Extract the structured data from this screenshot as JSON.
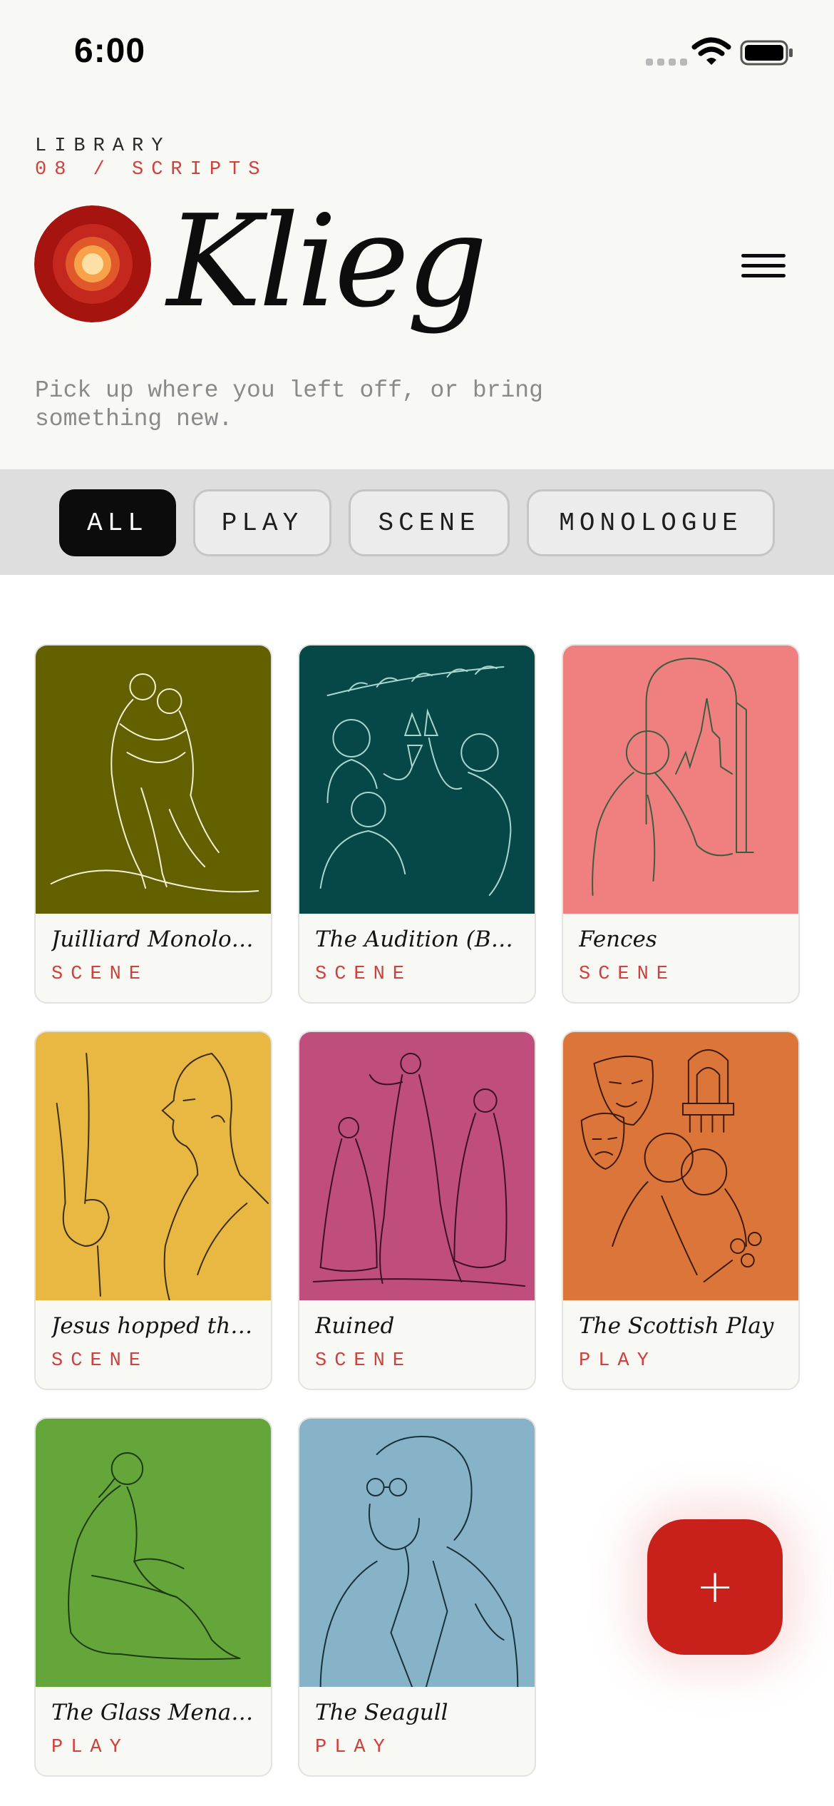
{
  "status_bar": {
    "time": "6:00"
  },
  "header": {
    "eyebrow_1": "LIBRARY",
    "eyebrow_2": "08 / SCRIPTS",
    "brand": "Klieg",
    "subtitle": "Pick up where you left off, or bring something new."
  },
  "filters": [
    "ALL",
    "PLAY",
    "SCENE",
    "MONOLOGUE"
  ],
  "active_filter": "ALL",
  "cards": [
    {
      "title": "Juilliard Monolog...",
      "type": "SCENE",
      "color": "#636000",
      "art": "embracing-couple-illustration"
    },
    {
      "title": "The Audition (Bro...",
      "type": "SCENE",
      "color": "#064848",
      "art": "toasting-group-illustration"
    },
    {
      "title": "Fences",
      "type": "SCENE",
      "color": "#f07f7f",
      "art": "woman-at-window-illustration"
    },
    {
      "title": "Jesus hopped the...",
      "type": "SCENE",
      "color": "#e9b843",
      "art": "profile-face-illustration"
    },
    {
      "title": "Ruined",
      "type": "SCENE",
      "color": "#c04e7c",
      "art": "three-women-illustration"
    },
    {
      "title": "The Scottish Play",
      "type": "PLAY",
      "color": "#dc753a",
      "art": "theatre-masks-illustration"
    },
    {
      "title": "The Glass Menage...",
      "type": "PLAY",
      "color": "#64a63a",
      "art": "seated-woman-illustration"
    },
    {
      "title": "The Seagull",
      "type": "PLAY",
      "color": "#86b3c8",
      "art": "bearded-man-portrait-illustration"
    }
  ],
  "fab": {
    "label": "+",
    "color": "#c8211c"
  },
  "colors": {
    "accent": "#d0403c",
    "background": "#f8f8f5",
    "filterbar": "#dedede"
  }
}
